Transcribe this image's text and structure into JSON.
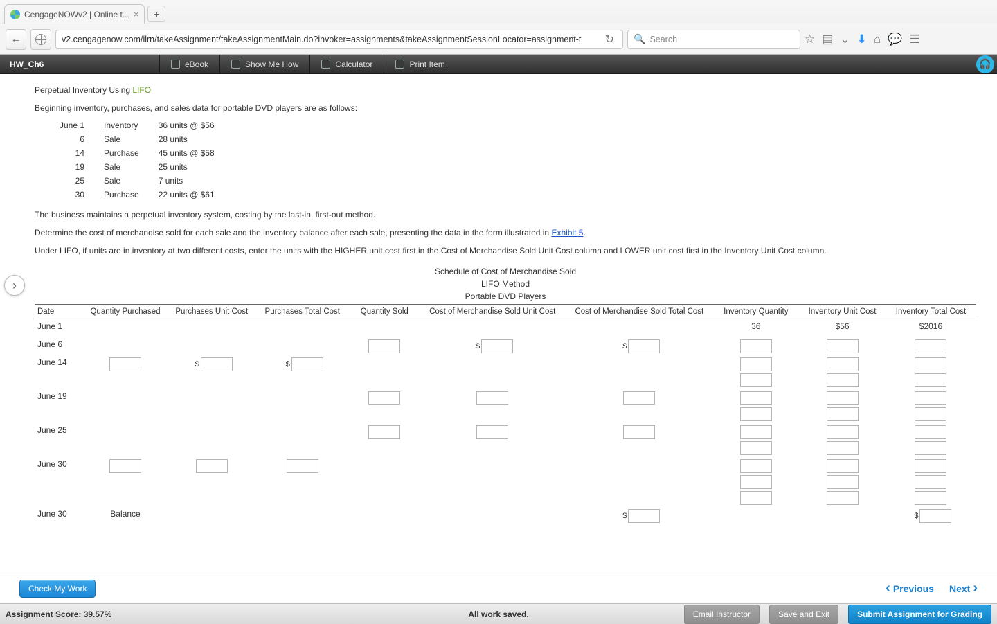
{
  "browser": {
    "tab_title": "CengageNOWv2 | Online t...",
    "url": "v2.cengagenow.com/ilrn/takeAssignment/takeAssignmentMain.do?invoker=assignments&takeAssignmentSessionLocator=assignment-t",
    "search_placeholder": "Search"
  },
  "appbar": {
    "assignment": "HW_Ch6",
    "buttons": {
      "ebook": "eBook",
      "show": "Show Me How",
      "calc": "Calculator",
      "print": "Print Item"
    }
  },
  "question": {
    "title_prefix": "Perpetual Inventory Using ",
    "title_method": "LIFO",
    "intro": "Beginning inventory, purchases, and sales data for portable DVD players are as follows:",
    "inv_rows": [
      {
        "date": "June 1",
        "type": "Inventory",
        "qty": "36 units @ $56"
      },
      {
        "date": "6",
        "type": "Sale",
        "qty": "28 units"
      },
      {
        "date": "14",
        "type": "Purchase",
        "qty": "45 units @ $58"
      },
      {
        "date": "19",
        "type": "Sale",
        "qty": "25 units"
      },
      {
        "date": "25",
        "type": "Sale",
        "qty": "7 units"
      },
      {
        "date": "30",
        "type": "Purchase",
        "qty": "22 units @ $61"
      }
    ],
    "para1": "The business maintains a perpetual inventory system, costing by the last-in, first-out method.",
    "para2_a": "Determine the cost of merchandise sold for each sale and the inventory balance after each sale, presenting the data in the form illustrated in ",
    "para2_link": "Exhibit 5",
    "para2_b": ".",
    "para3": "Under LIFO, if units are in inventory at two different costs, enter the units with the HIGHER unit cost first in the Cost of Merchandise Sold Unit Cost column and LOWER unit cost first in the Inventory Unit Cost column.",
    "schedule": {
      "line1": "Schedule of Cost of Merchandise Sold",
      "line2": "LIFO Method",
      "line3": "Portable DVD Players"
    },
    "headers": {
      "date": "Date",
      "qp": "Quantity Purchased",
      "puc": "Purchases Unit Cost",
      "ptc": "Purchases Total Cost",
      "qs": "Quantity Sold",
      "cuc": "Cost of Merchandise Sold Unit Cost",
      "ctc": "Cost of Merchandise Sold Total Cost",
      "iq": "Inventory Quantity",
      "iuc": "Inventory Unit Cost",
      "itc": "Inventory Total Cost"
    },
    "row_dates": {
      "r1": "June 1",
      "r2": "June 6",
      "r3": "June 14",
      "r4": "June 19",
      "r5": "June 25",
      "r6": "June 30",
      "r7": "June 30"
    },
    "prefilled": {
      "iq": "36",
      "iuc": "$56",
      "itc": "$2016"
    },
    "balance_label": "Balance",
    "dollar": "$"
  },
  "actions": {
    "check": "Check My Work",
    "previous": "Previous",
    "next": "Next"
  },
  "statusbar": {
    "score_label": "Assignment Score: ",
    "score_value": "39.57%",
    "saved": "All work saved.",
    "email": "Email Instructor",
    "save_exit": "Save and Exit",
    "submit": "Submit Assignment for Grading"
  }
}
